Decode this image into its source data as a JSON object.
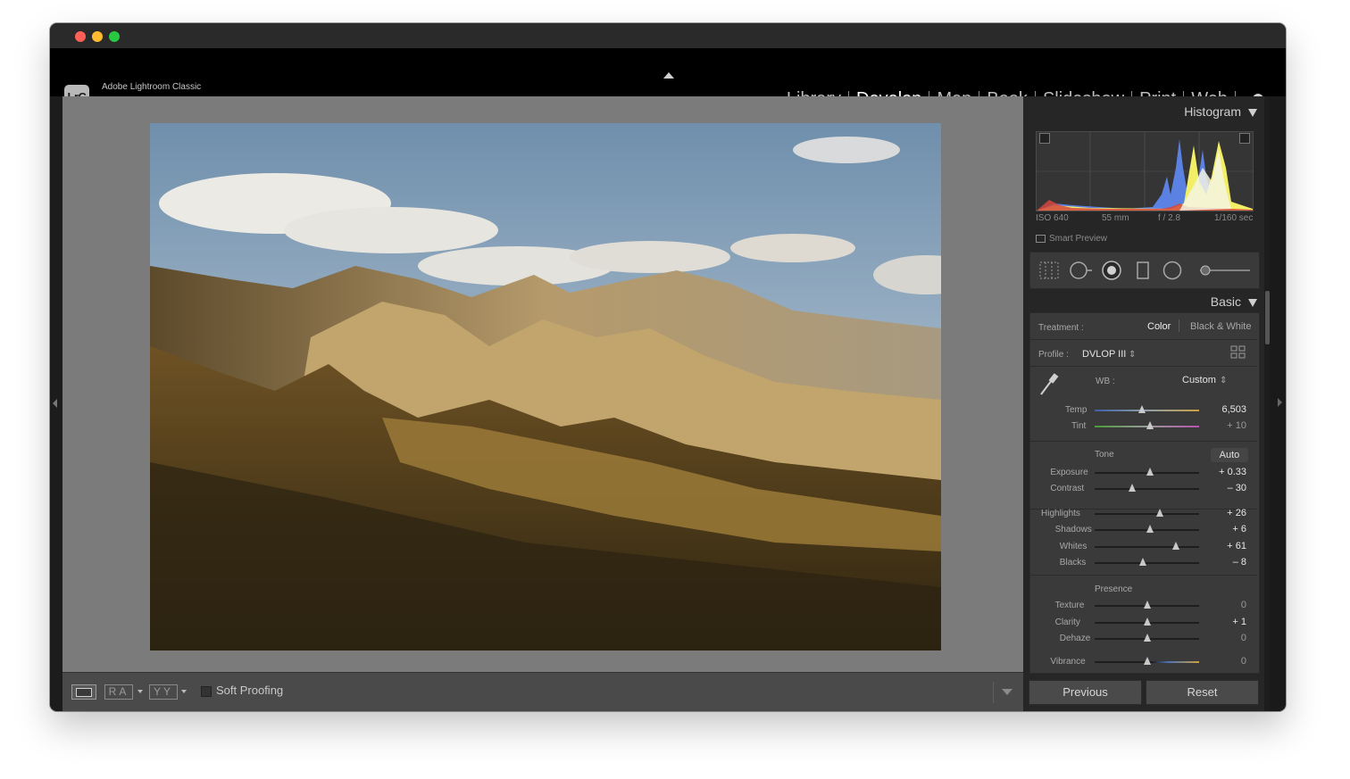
{
  "app": {
    "name": "Adobe Lightroom Classic",
    "logo": "LrC"
  },
  "modules": [
    "Library",
    "Develop",
    "Map",
    "Book",
    "Slideshow",
    "Print",
    "Web"
  ],
  "active_module": "Develop",
  "histogram": {
    "title": "Histogram",
    "iso": "ISO 640",
    "focal": "55 mm",
    "aperture": "f / 2.8",
    "shutter": "1/160 sec",
    "smart_preview": "Smart Preview",
    "channel_colors": {
      "blue": "#5b82e3",
      "yellow": "#f2ee66",
      "red": "#d4473d"
    }
  },
  "basic": {
    "title": "Basic",
    "treatment_label": "Treatment :",
    "treatment_color": "Color",
    "treatment_bw": "Black & White",
    "profile_label": "Profile :",
    "profile_value": "DVLOP III",
    "wb_label": "WB :",
    "wb_value": "Custom",
    "temp_label": "Temp",
    "temp_value": "6,503",
    "tint_label": "Tint",
    "tint_value": "+ 10",
    "tone_label": "Tone",
    "auto_label": "Auto",
    "presence_label": "Presence",
    "sliders": [
      {
        "key": "exposure",
        "label": "Exposure",
        "value": "+ 0.33",
        "pos": 0.53
      },
      {
        "key": "contrast",
        "label": "Contrast",
        "value": "– 30",
        "pos": 0.36
      },
      {
        "key": "highlights",
        "label": "Highlights",
        "value": "+ 26",
        "pos": 0.62
      },
      {
        "key": "shadows",
        "label": "Shadows",
        "value": "+ 6",
        "pos": 0.53
      },
      {
        "key": "whites",
        "label": "Whites",
        "value": "+ 61",
        "pos": 0.78
      },
      {
        "key": "blacks",
        "label": "Blacks",
        "value": "– 8",
        "pos": 0.46
      },
      {
        "key": "texture",
        "label": "Texture",
        "value": "0",
        "pos": 0.5
      },
      {
        "key": "clarity",
        "label": "Clarity",
        "value": "+ 1",
        "pos": 0.5
      },
      {
        "key": "dehaze",
        "label": "Dehaze",
        "value": "0",
        "pos": 0.5
      },
      {
        "key": "vibrance",
        "label": "Vibrance",
        "value": "0",
        "pos": 0.5
      }
    ],
    "temp_pos": 0.45,
    "tint_pos": 0.53
  },
  "toolbar": {
    "soft_proofing": "Soft Proofing",
    "ra": "RA",
    "yy": "YY"
  },
  "buttons": {
    "previous": "Previous",
    "reset": "Reset"
  }
}
